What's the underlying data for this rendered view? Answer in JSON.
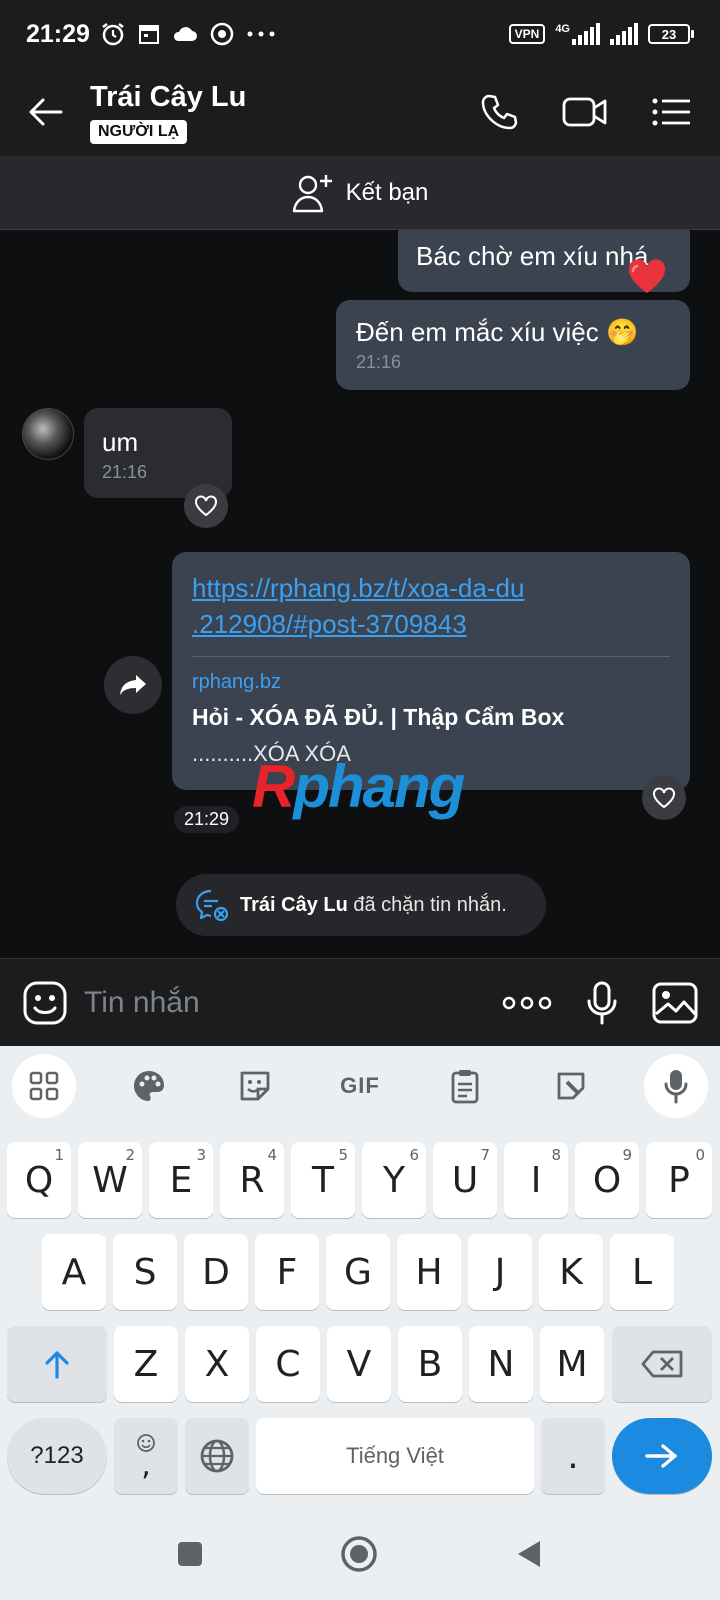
{
  "status_bar": {
    "time": "21:29",
    "vpn": "VPN",
    "network": "4G",
    "battery": "23"
  },
  "header": {
    "contact_name": "Trái Cây Lu",
    "badge": "NGƯỜI LẠ"
  },
  "add_friend": {
    "label": "Kết bạn"
  },
  "messages": [
    {
      "direction": "sent",
      "text": "Bác chờ em xíu nhá",
      "reaction": "heart"
    },
    {
      "direction": "sent",
      "text": "Đến em mắc xíu việc 🤭",
      "time": "21:16"
    },
    {
      "direction": "received",
      "text": "um",
      "time": "21:16"
    },
    {
      "direction": "sent",
      "link": "https://rphang.bz/t/xoa-da-du.212908/#post-3709843",
      "link_line1": "https://rphang.bz/t/xoa-da-du",
      "link_line2": ".212908/#post-3709843",
      "preview_domain": "rphang.bz",
      "preview_title": "Hỏi - XÓA ĐÃ ĐỦ. | Thập Cẩm Box",
      "preview_desc": "..........XÓA XÓA",
      "time": "21:29"
    }
  ],
  "watermark": {
    "r": "R",
    "rest": "phang"
  },
  "block_notice": {
    "name": "Trái Cây Lu",
    "text": " đã chặn tin nhắn."
  },
  "input": {
    "placeholder": "Tin nhắn",
    "more": "ooo"
  },
  "keyboard": {
    "gif_label": "GIF",
    "row1": [
      {
        "key": "Q",
        "hint": "1"
      },
      {
        "key": "W",
        "hint": "2"
      },
      {
        "key": "E",
        "hint": "3"
      },
      {
        "key": "R",
        "hint": "4"
      },
      {
        "key": "T",
        "hint": "5"
      },
      {
        "key": "Y",
        "hint": "6"
      },
      {
        "key": "U",
        "hint": "7"
      },
      {
        "key": "I",
        "hint": "8"
      },
      {
        "key": "O",
        "hint": "9"
      },
      {
        "key": "P",
        "hint": "0"
      }
    ],
    "row2": [
      "A",
      "S",
      "D",
      "F",
      "G",
      "H",
      "J",
      "K",
      "L"
    ],
    "row3": [
      "Z",
      "X",
      "C",
      "V",
      "B",
      "N",
      "M"
    ],
    "symbols_label": "?123",
    "comma": ",",
    "space_label": "Tiếng Việt",
    "period": "."
  },
  "colors": {
    "sent_bubble": "#3b4350",
    "received_bubble": "#2a2c30",
    "link": "#3aa0f0",
    "enter_key": "#1a8be0"
  }
}
